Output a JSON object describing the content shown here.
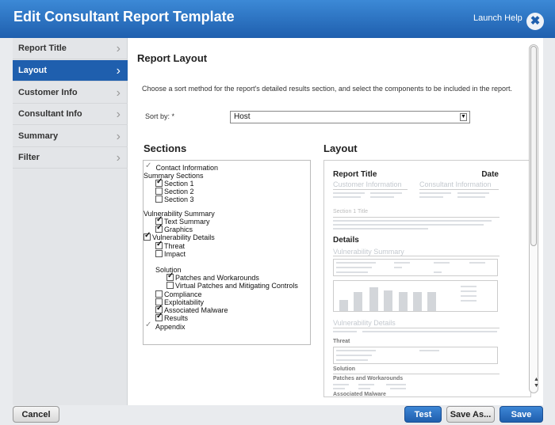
{
  "window": {
    "title": "Edit Consultant Report Template",
    "launch_help": "Launch Help",
    "close_glyph": "✖"
  },
  "sidebar": {
    "items": [
      {
        "label": "Report Title",
        "active": false
      },
      {
        "label": "Layout",
        "active": true
      },
      {
        "label": "Customer Info",
        "active": false
      },
      {
        "label": "Consultant Info",
        "active": false
      },
      {
        "label": "Summary",
        "active": false
      },
      {
        "label": "Filter",
        "active": false
      }
    ],
    "chevron": "›"
  },
  "main": {
    "title": "Report Layout",
    "description": "Choose a sort method for the report's detailed results section, and select the components to be included in the report.",
    "sort_label": "Sort by: *",
    "sort_value": "Host",
    "sections_heading": "Sections",
    "layout_heading": "Layout"
  },
  "sections": [
    {
      "label": "Contact Information",
      "checked": true,
      "disabled": true
    },
    {
      "label": "Summary Sections"
    },
    {
      "label": "Section 1",
      "checked": true
    },
    {
      "label": "Section 2",
      "checked": false
    },
    {
      "label": "Section 3",
      "checked": false
    },
    {
      "label": "Vulnerability Summary"
    },
    {
      "label": "Text Summary",
      "checked": true
    },
    {
      "label": "Graphics",
      "checked": true
    },
    {
      "label": "Vulnerability Details",
      "checked": true
    },
    {
      "label": "Threat",
      "checked": true
    },
    {
      "label": "Impact",
      "checked": false
    },
    {
      "label": "Solution"
    },
    {
      "label": "Patches and Workarounds",
      "checked": true
    },
    {
      "label": "Virtual Patches and Mitigating Controls",
      "checked": false
    },
    {
      "label": "Compliance",
      "checked": false
    },
    {
      "label": "Exploitability",
      "checked": false
    },
    {
      "label": "Associated Malware",
      "checked": true
    },
    {
      "label": "Results",
      "checked": true
    },
    {
      "label": "Appendix",
      "checked": true,
      "disabled": true
    }
  ],
  "preview": {
    "report_title": "Report Title",
    "date": "Date",
    "customer_info": "Customer Information",
    "consultant_info": "Consultant Information",
    "section_1_title": "Section 1 Title",
    "details": "Details",
    "vuln_summary": "Vulnerability Summary",
    "vuln_details": "Vulnerability Details",
    "threat": "Threat",
    "solution": "Solution",
    "patches": "Patches and Workarounds",
    "malware": "Associated Malware"
  },
  "footer": {
    "cancel": "Cancel",
    "test": "Test",
    "save_as": "Save As...",
    "save": "Save"
  },
  "colors": {
    "accent": "#1f5fae",
    "title_bar_top": "#3c89d6"
  }
}
